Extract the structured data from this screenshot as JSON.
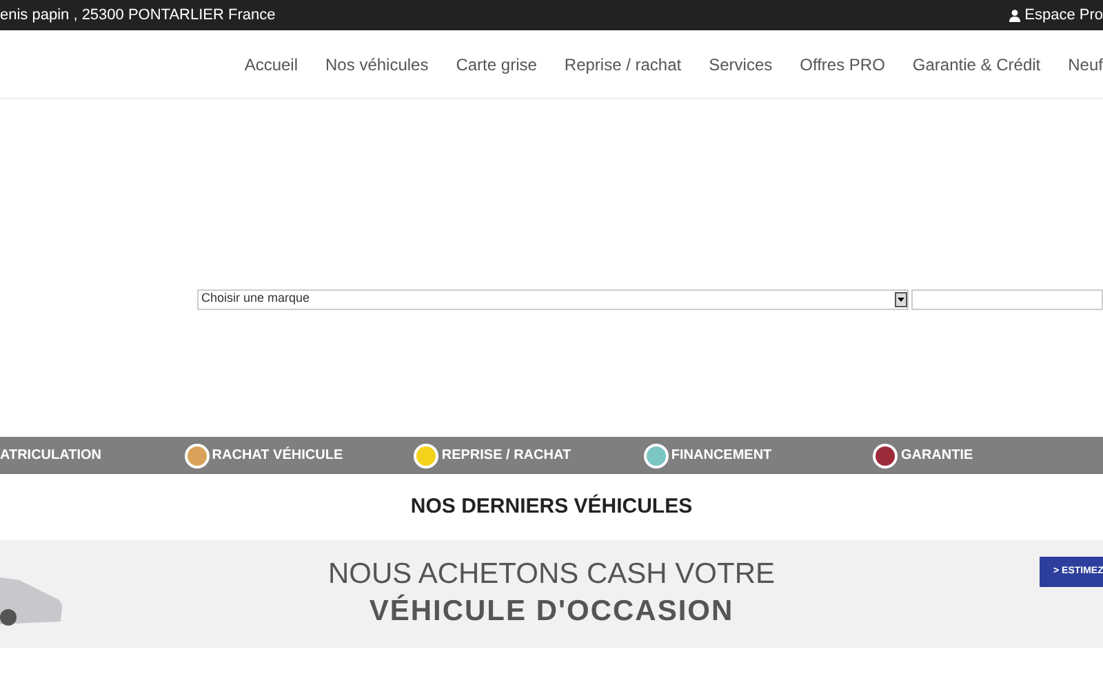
{
  "top_bar": {
    "address": "enis papin , 25300 PONTARLIER France",
    "account_link": "Espace Pro"
  },
  "nav": {
    "items": [
      {
        "label": "Accueil"
      },
      {
        "label": "Nos véhicules"
      },
      {
        "label": "Carte grise"
      },
      {
        "label": "Reprise / rachat"
      },
      {
        "label": "Services"
      },
      {
        "label": "Offres PRO"
      },
      {
        "label": "Garantie & Crédit"
      },
      {
        "label": "Neuf"
      }
    ]
  },
  "search": {
    "brand_select": "Choisir une marque"
  },
  "services_band": [
    {
      "label": "ATRICULATION"
    },
    {
      "label": "RACHAT VÉHICULE",
      "color": "#d9a25a"
    },
    {
      "label": "REPRISE / RACHAT",
      "color": "#f2d21b"
    },
    {
      "label": "FINANCEMENT",
      "color": "#7cc6c4"
    },
    {
      "label": "GARANTIE",
      "color": "#9c2a3a"
    }
  ],
  "latest_title": "NOS DERNIERS VÉHICULES",
  "promo": {
    "line_1": "NOUS ACHETONS CASH VOTRE",
    "line_2": "VÉHICULE D'OCCASION",
    "button": "> ESTIMEZ"
  }
}
